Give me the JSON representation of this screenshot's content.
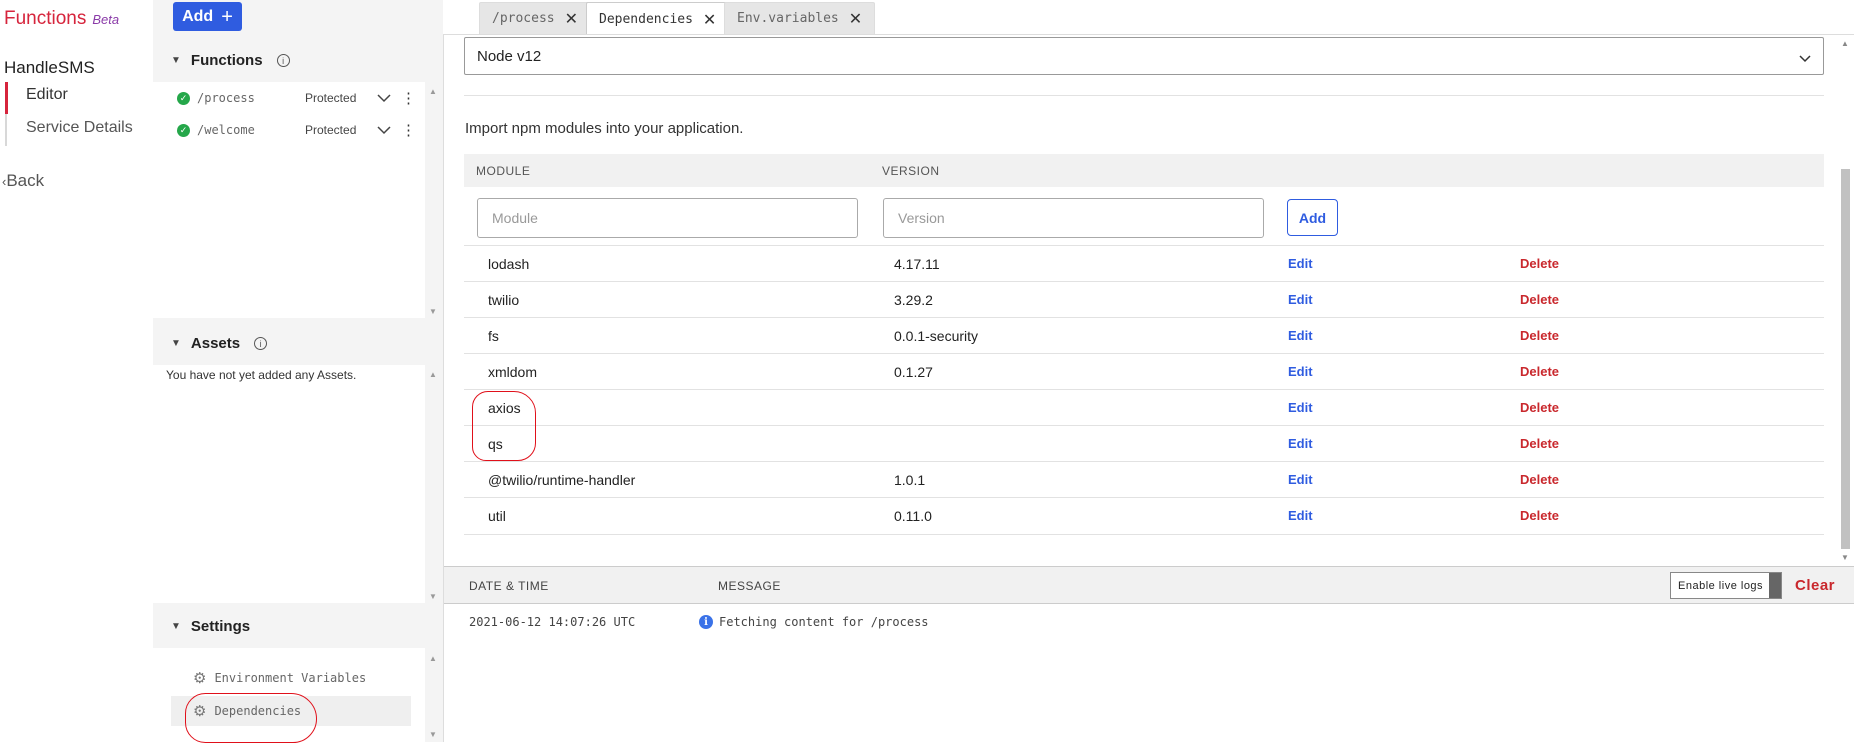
{
  "app": {
    "title": "Functions",
    "badge": "Beta"
  },
  "nav": {
    "service": "HandleSMS",
    "items": [
      {
        "label": "Editor",
        "active": true
      },
      {
        "label": "Service Details",
        "active": false
      }
    ],
    "back": "Back"
  },
  "sidebar": {
    "add_label": "Add",
    "functions_title": "Functions",
    "functions": [
      {
        "path": "/process",
        "visibility": "Protected"
      },
      {
        "path": "/welcome",
        "visibility": "Protected"
      }
    ],
    "assets_title": "Assets",
    "assets_empty": "You have not yet added any Assets.",
    "settings_title": "Settings",
    "settings_items": [
      "Environment Variables",
      "Dependencies"
    ]
  },
  "tabs": [
    {
      "label": "/process",
      "active": false
    },
    {
      "label": "Dependencies",
      "active": true
    },
    {
      "label": "Env.variables",
      "active": false
    }
  ],
  "deps": {
    "node_version": "Node v12",
    "intro": "Import npm modules into your application.",
    "col_module": "MODULE",
    "col_version": "VERSION",
    "module_placeholder": "Module",
    "version_placeholder": "Version",
    "add_label": "Add",
    "edit_label": "Edit",
    "delete_label": "Delete",
    "rows": [
      {
        "module": "lodash",
        "version": "4.17.11"
      },
      {
        "module": "twilio",
        "version": "3.29.2"
      },
      {
        "module": "fs",
        "version": "0.0.1-security"
      },
      {
        "module": "xmldom",
        "version": "0.1.27"
      },
      {
        "module": "axios",
        "version": ""
      },
      {
        "module": "qs",
        "version": ""
      },
      {
        "module": "@twilio/runtime-handler",
        "version": "1.0.1"
      },
      {
        "module": "util",
        "version": "0.11.0"
      }
    ]
  },
  "logs": {
    "col_datetime": "DATE & TIME",
    "col_message": "MESSAGE",
    "live_logs": "Enable live logs",
    "clear": "Clear",
    "entries": [
      {
        "time": "2021-06-12 14:07:26 UTC",
        "message": "Fetching content for /process"
      }
    ]
  },
  "colors": {
    "accent": "#2f5ce0",
    "brand": "#d6243c",
    "danger": "#c9282d",
    "success": "#25a74a",
    "annotation": "#e0101a"
  }
}
